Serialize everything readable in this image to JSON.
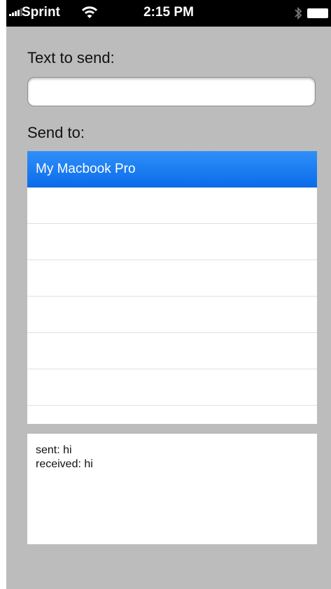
{
  "status_bar": {
    "carrier": "Sprint",
    "time": "2:15 PM"
  },
  "form": {
    "text_label": "Text to send:",
    "text_value": "",
    "send_to_label": "Send to:"
  },
  "devices": {
    "rows": [
      "My Macbook Pro",
      "",
      "",
      "",
      "",
      "",
      "",
      ""
    ],
    "selected_index": 0
  },
  "log": {
    "lines": [
      "sent: hi",
      "received: hi"
    ]
  },
  "colors": {
    "background": "#bcbcbc",
    "selection": "#1a7af2"
  }
}
